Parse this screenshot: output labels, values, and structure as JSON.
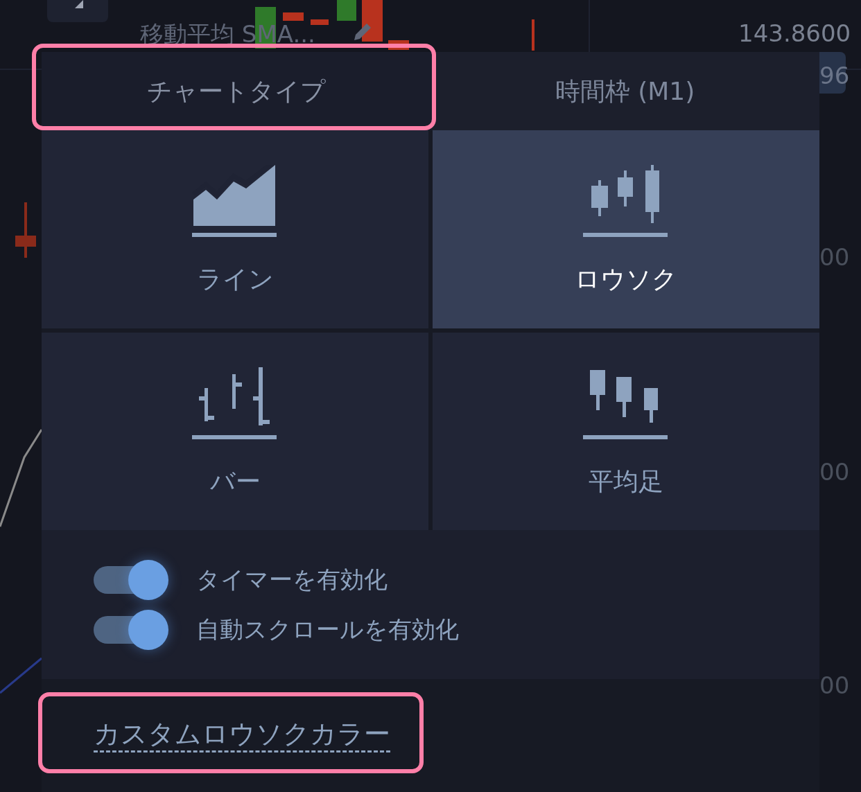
{
  "background_chart": {
    "indicator_label": "移動平均 SMA...",
    "price_labels": [
      "143.8600",
      "96",
      "00",
      "00",
      "00"
    ]
  },
  "tabs": [
    {
      "label": "チャートタイプ",
      "selected": true,
      "highlighted": true
    },
    {
      "label": "時間枠 (M1)",
      "selected": false,
      "highlighted": false
    }
  ],
  "chart_types": [
    {
      "label": "ライン",
      "kind": "line",
      "selected": false
    },
    {
      "label": "ロウソク",
      "kind": "candles",
      "selected": true
    },
    {
      "label": "バー",
      "kind": "bars",
      "selected": false
    },
    {
      "label": "平均足",
      "kind": "heikin",
      "selected": false
    }
  ],
  "toggles": [
    {
      "label": "タイマーを有効化",
      "on": true
    },
    {
      "label": "自動スクロールを有効化",
      "on": true
    }
  ],
  "custom_colors_link": {
    "label": "カスタムロウソクカラー",
    "highlighted": true
  }
}
